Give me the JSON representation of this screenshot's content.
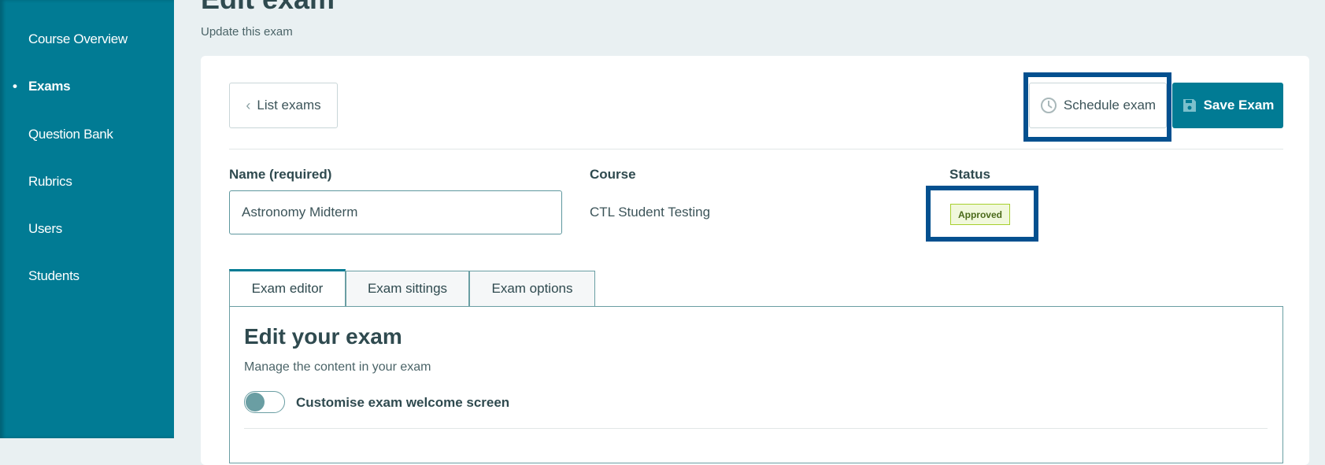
{
  "sidebar": {
    "items": [
      {
        "label": "Course Overview",
        "active": false
      },
      {
        "label": "Exams",
        "active": true
      },
      {
        "label": "Question Bank",
        "active": false
      },
      {
        "label": "Rubrics",
        "active": false
      },
      {
        "label": "Users",
        "active": false
      },
      {
        "label": "Students",
        "active": false
      }
    ]
  },
  "header": {
    "title": "Edit exam",
    "subtitle": "Update this exam"
  },
  "toolbar": {
    "back_label": "List exams",
    "back_icon": "chevron-left-icon",
    "schedule_label": "Schedule exam",
    "schedule_icon": "clock-icon",
    "save_label": "Save Exam",
    "save_icon": "floppy-disk-icon"
  },
  "form": {
    "name_label": "Name (required)",
    "name_value": "Astronomy Midterm",
    "course_label": "Course",
    "course_value": "CTL Student Testing",
    "status_label": "Status",
    "status_value": "Approved"
  },
  "tabs": [
    {
      "label": "Exam editor",
      "active": true
    },
    {
      "label": "Exam sittings"
    },
    {
      "label": "Exam options"
    }
  ],
  "editor": {
    "heading": "Edit your exam",
    "description": "Manage the content in your exam",
    "toggle_label": "Customise exam welcome screen",
    "toggle_on": false
  },
  "colors": {
    "primary": "#017b94",
    "highlight": "#03508f",
    "badge_bg": "#f1f8dc",
    "badge_border": "#a7cf2e"
  }
}
